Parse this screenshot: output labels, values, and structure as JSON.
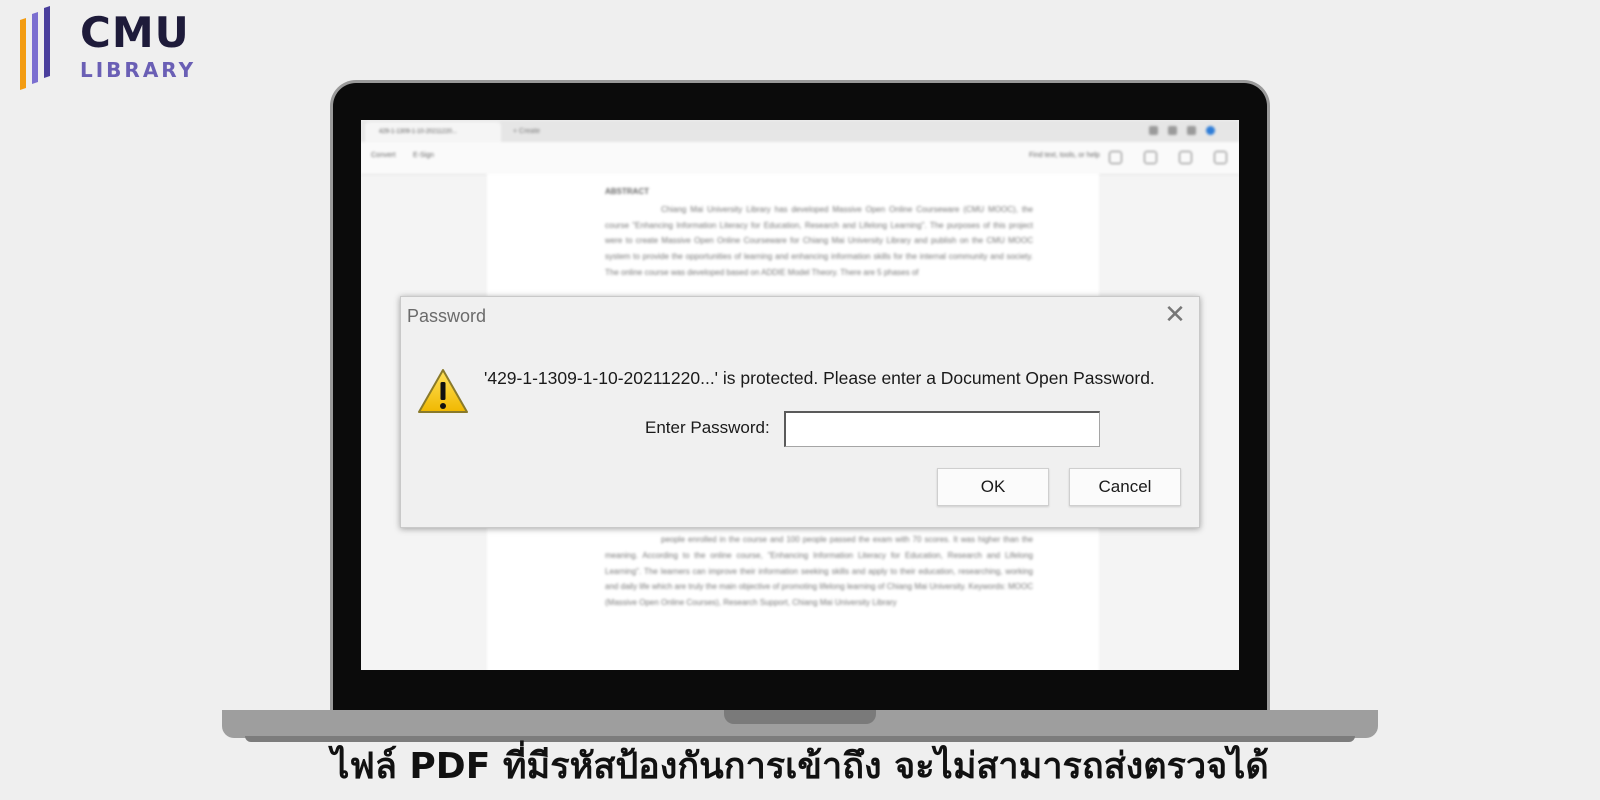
{
  "logo": {
    "line1": "CMU",
    "line2": "LIBRARY"
  },
  "viewer": {
    "tab_title": "429-1-1309-1-10-20211220...",
    "new_tab": "+ Create",
    "toolbar": {
      "convert": "Convert",
      "esign": "E-Sign",
      "find": "Find text, tools, or help"
    },
    "document": {
      "heading": "ABSTRACT",
      "paragraph_top": "Chiang Mai University Library has developed Massive Open Online Courseware (CMU MOOC), the course \"Enhancing Information Literacy for Education, Research and Lifelong Learning\". The purposes of this project were to create Massive Open Online Courseware for Chiang Mai University Library and publish on the CMU MOOC system to provide the opportunities of learning and enhancing information skills for the internal community and society. The online course was developed based on ADDIE Model Theory. There are 5 phases of",
      "paragraph_bottom": "people enrolled in the course and 100 people passed the exam with 70 scores. It was higher than the meaning. According to the online course, \"Enhancing Information Literacy for Education, Research and Lifelong Learning\". The learners can improve their information seeking skills and apply to their education, researching, working and daily life which are truly the main objective of promoting lifelong learning of Chiang Mai University. Keywords: MOOC (Massive Open Online Courses), Research Support, Chiang Mai University Library"
    }
  },
  "dialog": {
    "title": "Password",
    "close_icon": "close-icon",
    "warning_icon": "warning-triangle-icon",
    "message": "'429-1-1309-1-10-20211220...' is protected. Please enter a Document Open Password.",
    "password_label": "Enter Password:",
    "password_value": "",
    "ok_label": "OK",
    "cancel_label": "Cancel"
  },
  "caption": "ไฟล์ PDF ที่มีรหัสป้องกันการเข้าถึง จะไม่สามารถส่งตรวจได้",
  "colors": {
    "logo_dark": "#1e1b3a",
    "logo_purple": "#6a5fb5",
    "logo_orange": "#f39c12",
    "warning_yellow": "#f5c400"
  }
}
